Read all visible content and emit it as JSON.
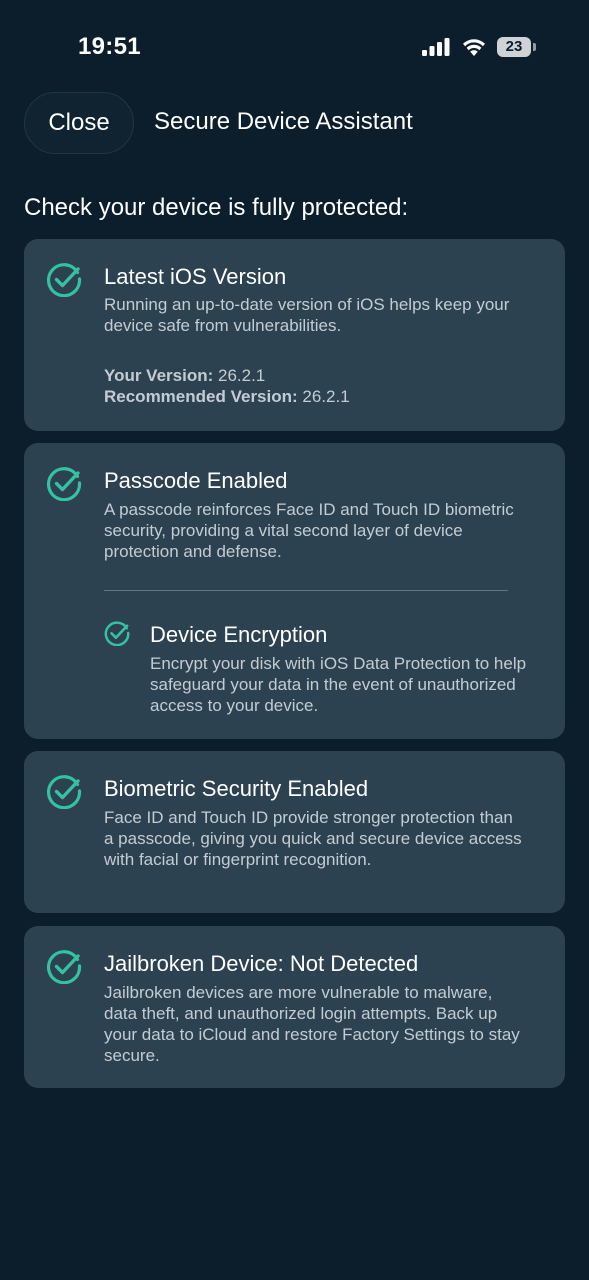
{
  "status_bar": {
    "time": "19:51",
    "battery": "23"
  },
  "header": {
    "close_label": "Close",
    "title": "Secure Device Assistant"
  },
  "section_heading": "Check your device is fully protected:",
  "accent_color": "#34c2a0",
  "cards": [
    {
      "title": "Latest iOS Version",
      "description": "Running an up-to-date version of iOS helps keep your device safe from vulnerabilities.",
      "your_version_label": "Your Version:",
      "your_version": "26.2.1",
      "recommended_label": "Recommended Version:",
      "recommended_version": "26.2.1"
    },
    {
      "title": "Passcode Enabled",
      "description": "A passcode reinforces Face ID and Touch ID biometric security, providing a vital second layer of device protection and defense.",
      "sub_title": "Device Encryption",
      "sub_description": "Encrypt your disk with iOS Data Protection to help safeguard your data in the event of unauthorized access to your device."
    },
    {
      "title": "Biometric Security Enabled",
      "description": "Face ID and Touch ID provide stronger protection than a passcode, giving you quick and secure device access with facial or fingerprint recognition."
    },
    {
      "title": "Jailbroken Device: Not Detected",
      "description": "Jailbroken devices are more vulnerable to malware, data theft, and unauthorized login attempts. Back up your data to iCloud and restore Factory Settings to stay secure."
    }
  ]
}
